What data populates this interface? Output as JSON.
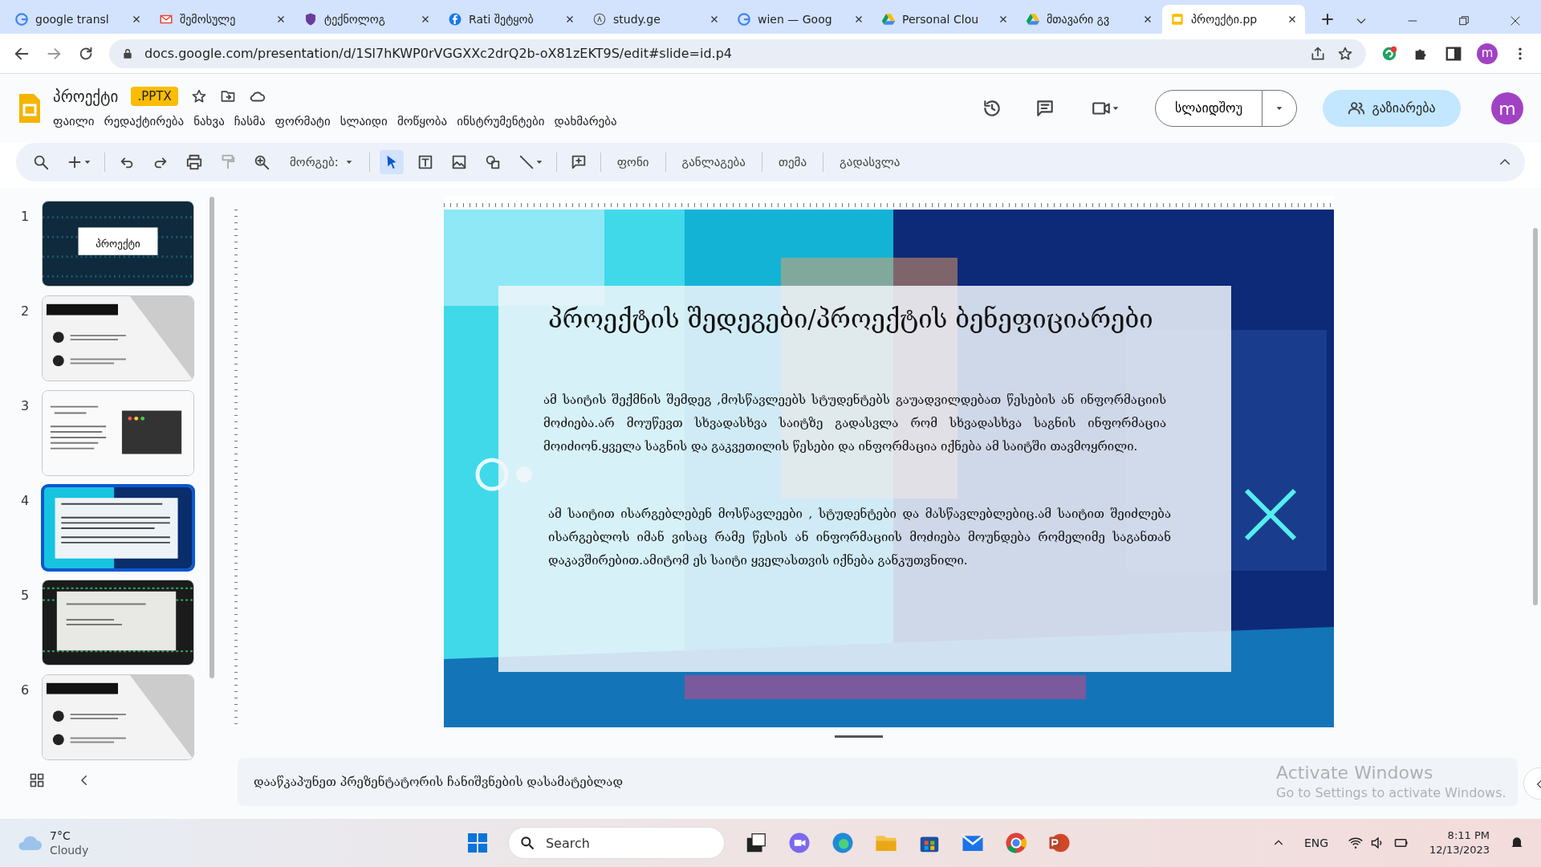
{
  "browser": {
    "tabs": [
      {
        "title": "google transl",
        "selected": false
      },
      {
        "title": "შემოსულე",
        "selected": false
      },
      {
        "title": "ტექნოლოგ",
        "selected": false
      },
      {
        "title": "Rati შეტყობ",
        "selected": false
      },
      {
        "title": "study.ge",
        "selected": false
      },
      {
        "title": "wien — Goog",
        "selected": false
      },
      {
        "title": "Personal Clou",
        "selected": false
      },
      {
        "title": "მთავარი გვ",
        "selected": false
      },
      {
        "title": "პროექტი.pp",
        "selected": true
      }
    ],
    "url": "docs.google.com/presentation/d/1Sl7hKWP0rVGGXXc2drQ2b-oX81zEKT9S/edit#slide=id.p4",
    "avatar": "m"
  },
  "doc": {
    "title": "პროექტი",
    "badge": ".PPTX",
    "menu": [
      "ფაილი",
      "რედაქტირება",
      "ნახვა",
      "ჩასმა",
      "ფორმატი",
      "სლაიდი",
      "მოწყობა",
      "ინსტრუმენტები",
      "დახმარება"
    ],
    "slideshow": "სლაიდშოუ",
    "share": "გაზიარება",
    "avatar": "m"
  },
  "toolbar": {
    "zoom": "მორგებ:",
    "buttons": [
      "ფონი",
      "განლაგება",
      "თემა",
      "გადასვლა"
    ]
  },
  "slides": [
    {
      "number": "1",
      "kind": "dark-title",
      "title": "პროექტი",
      "selected": false
    },
    {
      "number": "2",
      "kind": "diagonal",
      "selected": false
    },
    {
      "number": "3",
      "kind": "code-window",
      "selected": false
    },
    {
      "number": "4",
      "kind": "cyan-box",
      "selected": true
    },
    {
      "number": "5",
      "kind": "dark-box",
      "selected": false
    },
    {
      "number": "6",
      "kind": "diagonal",
      "selected": false
    }
  ],
  "slide": {
    "title": "პროექტის შედეგები/პროექტის ბენეფიციარები",
    "paragraphs": [
      "ამ საიტის შექმნის შემდეგ ,მოსწავლეებს სტუდენტებს გაუადვილდებათ წესების ან ინფორმაციის მოძიება.არ მოუწევთ სხვადასხვა საიტზე გადასვლა რომ სხვადასხვა საგნის ინფორმაცია მოიძიონ.ყველა საგნის და გაკვეთილის წესები და ინფორმაცია იქნება ამ საიტში თავმოყრილი.",
      "ამ საიტით ისარგებლებენ მოსწავლეები , სტუდენტები და მასწავლებლებიც.ამ საიტით შეიძლება ისარგებლოს იმან ვისაც რამე წესის ან ინფორმაციის მოძიება მოუნდება რომელიმე საგანთან დაკავშირებით.ამიტომ ეს საიტი ყველასთვის იქნება განკუთვნილი."
    ]
  },
  "notes": {
    "placeholder": "დააწკაპუნეთ პრეზენტატორის ჩანიშვნების დასამატებლად"
  },
  "activation": {
    "title": "Activate Windows",
    "subtitle": "Go to Settings to activate Windows."
  },
  "taskbar": {
    "temperature": "7°C",
    "weather": "Cloudy",
    "search_placeholder": "Search",
    "language": "ENG",
    "time": "8:11 PM",
    "date": "12/13/2023"
  }
}
